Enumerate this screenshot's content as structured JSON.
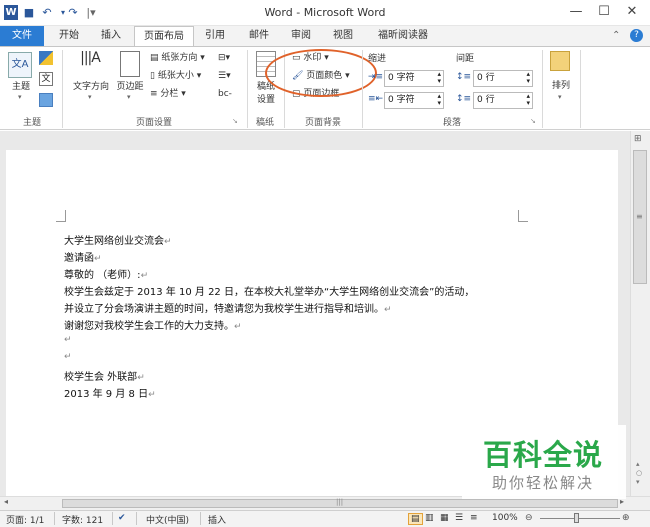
{
  "window": {
    "title": "Word - Microsoft Word",
    "logo": "W"
  },
  "quick_access": {
    "save_icon": "save-icon",
    "undo_icon": "undo-icon",
    "redo_icon": "redo-icon",
    "customize_icon": "customize-qat-icon"
  },
  "window_controls": {
    "help": "?",
    "minimize": "—",
    "maximize": "☐",
    "close": "✕"
  },
  "tabs": [
    {
      "label": "文件",
      "active": false
    },
    {
      "label": "开始",
      "active": false
    },
    {
      "label": "插入",
      "active": false
    },
    {
      "label": "页面布局",
      "active": true
    },
    {
      "label": "引用",
      "active": false
    },
    {
      "label": "邮件",
      "active": false
    },
    {
      "label": "审阅",
      "active": false
    },
    {
      "label": "视图",
      "active": false
    },
    {
      "label": "福昕阅读器",
      "active": false
    }
  ],
  "ribbon": {
    "theme_group": {
      "label": "主题",
      "themes_button": "主题"
    },
    "page_setup": {
      "label": "页面设置",
      "text_direction": "文字方向",
      "margins": "页边距",
      "orientation": "纸张方向",
      "size": "纸张大小",
      "columns": "分栏",
      "breaks_suffix": "-",
      "hyphen": "bc-"
    },
    "manuscript": {
      "label": "稿纸",
      "button": "稿纸\n设置",
      "button_line1": "稿纸",
      "button_line2": "设置"
    },
    "page_background": {
      "label": "页面背景",
      "watermark": "水印",
      "page_color": "页面颜色",
      "page_borders": "页面边框"
    },
    "paragraph": {
      "label": "段落",
      "indent_header": "缩进",
      "spacing_header": "间距",
      "indent_left": "0 字符",
      "indent_right": "0 字符",
      "spacing_before": "0 行",
      "spacing_after": "0 行"
    },
    "arrange": {
      "label": "排列",
      "button": "排列"
    }
  },
  "document": {
    "lines": [
      "大学生网络创业交流会",
      "邀请函",
      "尊敬的          （老师）:",
      "校学生会兹定于 2013 年 10 月 22 日，在本校大礼堂举办“大学生网络创业交流会”的活动，",
      "并设立了分会场演讲主题的时间，特邀请您为我校学生进行指导和培训。",
      "谢谢您对我校学生会工作的大力支持。",
      "",
      "",
      "校学生会 外联部",
      "2013 年 9 月 8 日"
    ],
    "paragraph_mark": "↵"
  },
  "status_bar": {
    "page": "页面: 1/1",
    "words": "字数: 121",
    "language": "中文(中国)",
    "insert_mode": "插入",
    "zoom": "100%"
  },
  "watermark": {
    "title": "百科全说",
    "subtitle": "助你轻松解决"
  },
  "colors": {
    "file_tab": "#2b7cd3",
    "highlight": "#e0622a",
    "watermark_green": "#2aa84a"
  }
}
